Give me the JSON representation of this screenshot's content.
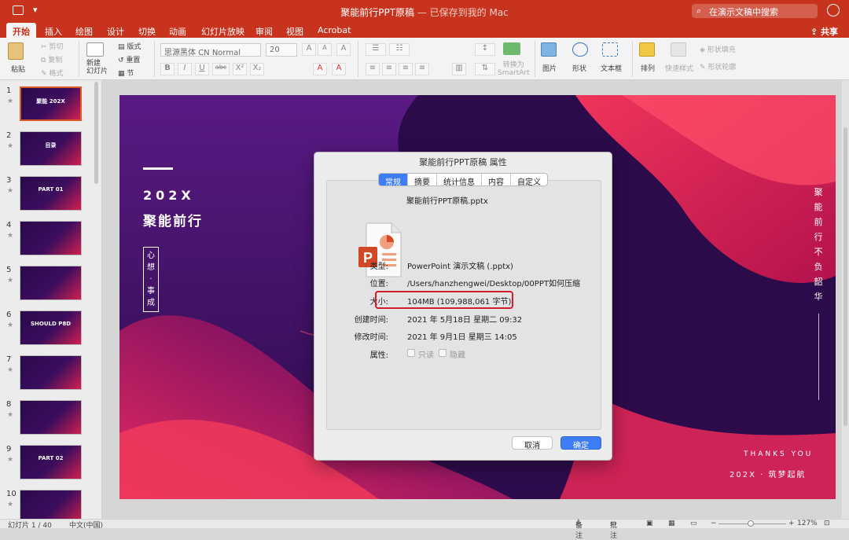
{
  "titlebar": {
    "title": "聚能前行PPT原稿",
    "subtitle": " — 已保存到我的 Mac",
    "search_placeholder": "在演示文稿中搜索"
  },
  "tabs": [
    "开始",
    "插入",
    "绘图",
    "设计",
    "切换",
    "动画",
    "幻灯片放映",
    "审阅",
    "视图",
    "Acrobat"
  ],
  "share_label": "共享",
  "ribbon": {
    "paste": "粘贴",
    "cut": "剪切",
    "copy": "复制",
    "format": "格式",
    "new_slide": "新建\n幻灯片",
    "layout": "版式",
    "reset": "重置",
    "section": "节",
    "font_name": "思源黑体 CN Normal",
    "font_size": "20",
    "bold": "B",
    "italic": "I",
    "underline": "U",
    "strike": "abc",
    "superscript": "X²",
    "subscript": "X₂",
    "font_grow": "A",
    "font_shrink": "A",
    "clear_format": "A",
    "highlight": "A",
    "font_color": "A",
    "smartart": "转换为\nSmartArt",
    "picture": "图片",
    "shape": "形状",
    "textbox": "文本框",
    "arrange": "排列",
    "quick_styles": "快速样式",
    "shape_fill": "形状填充",
    "shape_outline": "形状轮廓"
  },
  "thumbnails": [
    {
      "num": "1",
      "text": "聚能 202X"
    },
    {
      "num": "2",
      "text": "目录"
    },
    {
      "num": "3",
      "text": "PART 01"
    },
    {
      "num": "4",
      "text": ""
    },
    {
      "num": "5",
      "text": ""
    },
    {
      "num": "6",
      "text": "SHOULD P8D"
    },
    {
      "num": "7",
      "text": ""
    },
    {
      "num": "8",
      "text": ""
    },
    {
      "num": "9",
      "text": "PART 02"
    },
    {
      "num": "10",
      "text": ""
    }
  ],
  "slide": {
    "year": "202X",
    "headline": "聚能前行",
    "vertical_box": "心\n想\n·\n事\n成",
    "right_vertical": "聚\n能\n前\n行\n不\n负\n韶\n华",
    "thanks": "THANKS YOU",
    "bottom_right": "202X · 筑梦起航"
  },
  "dialog": {
    "title": "聚能前行PPT原稿 属性",
    "tabs": [
      {
        "label": "常规",
        "active": true
      },
      {
        "label": "摘要",
        "active": false
      },
      {
        "label": "统计信息",
        "active": false
      },
      {
        "label": "内容",
        "active": false
      },
      {
        "label": "自定义",
        "active": false
      }
    ],
    "filename": "聚能前行PPT原稿.pptx",
    "type_label": "类型:",
    "type_value": "PowerPoint 演示文稿 (.pptx)",
    "location_label": "位置:",
    "location_value": "/Users/hanzhengwei/Desktop/00PPT如何压缩",
    "size_label": "大小:",
    "size_value": "104MB (109,988,061 字节)",
    "created_label": "创建时间:",
    "created_value": "2021 年 5月18日 星期二 09:32",
    "modified_label": "修改时间:",
    "modified_value": "2021 年 9月1日 星期三 14:05",
    "attributes_label": "属性:",
    "readonly_label": "只读",
    "hidden_label": "隐藏",
    "cancel": "取消",
    "ok": "确定"
  },
  "status": {
    "slide_count": "幻灯片 1 / 40",
    "language": "中文(中国)",
    "notes": "备注",
    "comments": "批注",
    "zoom": "127%"
  },
  "colors": {
    "accent": "#c8331e",
    "dialog_blue": "#3d7df6",
    "highlight_red": "#d21d2a"
  }
}
